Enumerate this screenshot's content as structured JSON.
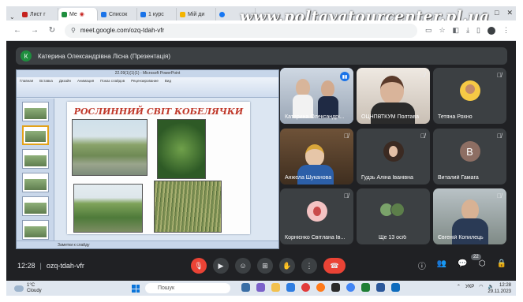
{
  "browser": {
    "tabs": [
      {
        "label": "Лист г",
        "color": "#c5221f"
      },
      {
        "label": "Me",
        "color": "#1e8e3e",
        "active": true
      },
      {
        "label": "Список",
        "color": "#1a73e8"
      },
      {
        "label": "1 курс",
        "color": "#1a73e8"
      },
      {
        "label": "Мій ди",
        "color": "#f4b400"
      },
      {
        "label": "",
        "color": "#1877f2"
      }
    ],
    "url": "meet.google.com/ozq-tdah-vfr",
    "watermark": "www.poltavatourcenter.pl.ua"
  },
  "presenter": {
    "avatar_letter": "К",
    "name": "Катерина Олександрівна Лісна (Презентація)"
  },
  "presentation": {
    "window_title": "22.09(1)(1)(1) - Microsoft PowerPoint",
    "slide_title": "РОСЛИННИЙ СВІТ КОБЕЛЯЧКИ",
    "notes_placeholder": "Заметки к слайду",
    "ribbon_tabs": [
      "Главная",
      "Вставка",
      "Дизайн",
      "Анимация",
      "Показ слайдов",
      "Рецензирование",
      "Вид"
    ]
  },
  "participants": [
    {
      "name": "Катерина Олександрі...",
      "speaking": true,
      "type": "video"
    },
    {
      "name": "ОЦНПВТКУМ Полтава",
      "muted": true,
      "type": "video"
    },
    {
      "name": "Тетяна Рохно",
      "muted": true,
      "type": "avatar"
    },
    {
      "name": "Анжела Шуканова",
      "muted": true,
      "type": "video"
    },
    {
      "name": "Гудзь Аліна Іванівна",
      "muted": true,
      "type": "avatar"
    },
    {
      "name": "Виталий Гамага",
      "muted": true,
      "type": "letter",
      "letter": "В",
      "color": "#8d6e63"
    },
    {
      "name": "Корнієнко Світлана Ів...",
      "muted": true,
      "type": "avatar"
    },
    {
      "name": "Ще 13 осіб",
      "type": "more"
    },
    {
      "name": "Євгеній Копилець",
      "muted": true,
      "type": "video"
    }
  ],
  "meeting": {
    "time": "12:28",
    "code": "ozq-tdah-vfr",
    "people_count": "22"
  },
  "taskbar": {
    "temp": "1°C",
    "weather": "Cloudy",
    "search_placeholder": "Пошук",
    "lang": "УКР",
    "time": "12:28",
    "date": "29.11.2023"
  }
}
